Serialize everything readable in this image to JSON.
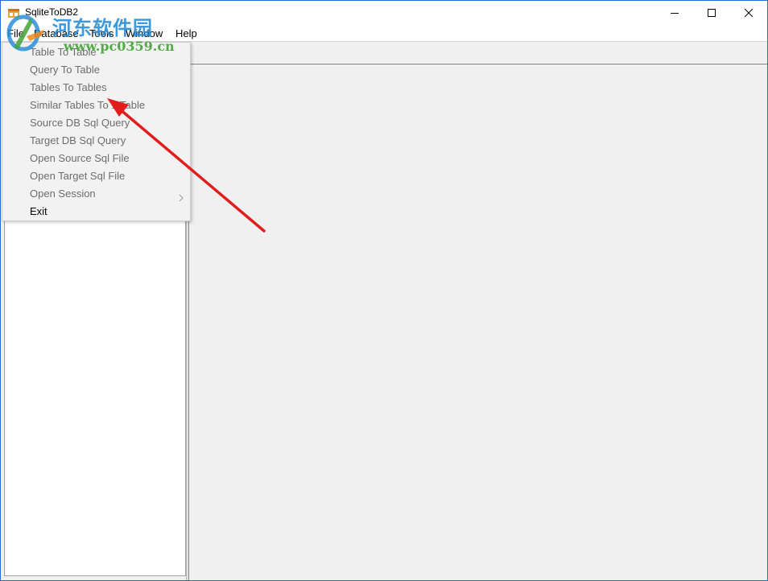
{
  "window": {
    "title": "SqliteToDB2",
    "minimize_icon": "minimize-icon",
    "maximize_icon": "maximize-icon",
    "close_icon": "close-icon",
    "app_icon": "database-app-icon"
  },
  "menubar": {
    "items": [
      {
        "label": "File"
      },
      {
        "label": "Database"
      },
      {
        "label": "Tools"
      },
      {
        "label": "Window"
      },
      {
        "label": "Help"
      }
    ]
  },
  "file_menu": {
    "items": [
      {
        "label": "Table To Table",
        "enabled": false
      },
      {
        "label": "Query To Table",
        "enabled": false
      },
      {
        "label": "Tables To Tables",
        "enabled": false
      },
      {
        "label": "Similar Tables To 1 Table",
        "enabled": false
      },
      {
        "label": "Source DB Sql Query",
        "enabled": false
      },
      {
        "label": "Target DB Sql Query",
        "enabled": false
      },
      {
        "label": "Open Source Sql File",
        "enabled": false
      },
      {
        "label": "Open Target Sql File",
        "enabled": false
      },
      {
        "label": "Open Session",
        "enabled": false,
        "submenu": true
      },
      {
        "label": "Exit",
        "enabled": true
      }
    ]
  },
  "watermark": {
    "title": "河东软件园",
    "url": "www.pc0359.cn"
  },
  "colors": {
    "window_border": "#1e6fd9",
    "menu_bg": "#f2f2f2",
    "disabled_text": "#6d6d6d",
    "arrow": "#e01e1e",
    "watermark_blue": "#2a8fd8",
    "watermark_green": "#43a336"
  }
}
